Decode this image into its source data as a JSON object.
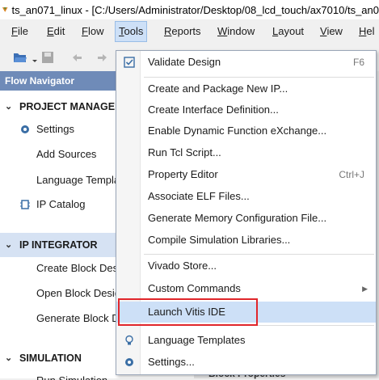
{
  "window": {
    "title": "ts_an071_linux - [C:/Users/Administrator/Desktop/08_lcd_touch/ax7010/ts_an0"
  },
  "menubar": {
    "items": [
      {
        "label": "File",
        "u": "F",
        "rest": "ile"
      },
      {
        "label": "Edit",
        "u": "E",
        "rest": "dit"
      },
      {
        "label": "Flow",
        "u": "F",
        "rest": "low"
      },
      {
        "label": "Tools",
        "u": "T",
        "rest": "ools"
      },
      {
        "label": "Reports",
        "u": "R",
        "rest": "eports"
      },
      {
        "label": "Window",
        "u": "W",
        "rest": "indow"
      },
      {
        "label": "Layout",
        "u": "L",
        "rest": "ayout"
      },
      {
        "label": "View",
        "u": "V",
        "rest": "iew"
      },
      {
        "label": "Hel",
        "u": "H",
        "rest": "el"
      }
    ]
  },
  "flow_navigator": {
    "title": "Flow Navigator",
    "project_manager": "PROJECT MANAGER",
    "settings": "Settings",
    "add_sources": "Add Sources",
    "language_templates": "Language Templa",
    "ip_catalog": "IP Catalog",
    "ip_integrator": "IP INTEGRATOR",
    "create_block": "Create Block Desi",
    "open_block": "Open Block Desig",
    "generate_block": "Generate Block D",
    "simulation": "SIMULATION",
    "run_sim": "Run Simulation"
  },
  "right_panel": {
    "block_properties": "Block Properties"
  },
  "tools_menu": {
    "validate_design": "Validate Design",
    "validate_shortcut": "F6",
    "create_package_ip": "Create and Package New IP...",
    "create_interface": "Create Interface Definition...",
    "enable_dfx": "Enable Dynamic Function eXchange...",
    "run_tcl": "Run Tcl Script...",
    "property_editor": "Property Editor",
    "property_shortcut": "Ctrl+J",
    "associate_elf": "Associate ELF Files...",
    "gen_mem_config": "Generate Memory Configuration File...",
    "compile_sim_libs": "Compile Simulation Libraries...",
    "vivado_store": "Vivado Store...",
    "custom_commands": "Custom Commands",
    "launch_vitis": "Launch Vitis IDE",
    "language_templates": "Language Templates",
    "settings": "Settings..."
  }
}
